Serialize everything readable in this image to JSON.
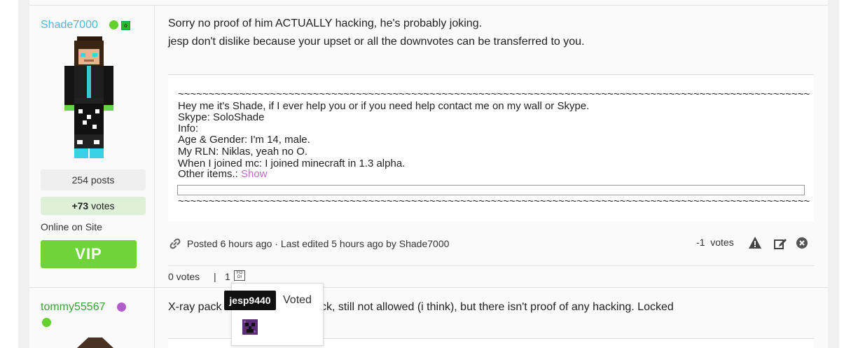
{
  "post1": {
    "author": {
      "username": "Shade7000",
      "posts_label": "254 posts",
      "votes_value": "+73",
      "votes_suffix": " votes",
      "status": "Online on Site",
      "rank": "VIP",
      "badge_text": "o"
    },
    "body_lines": [
      "Sorry no proof of him ACTUALLY hacking, he's probably joking.",
      "jesp don't dislike because your upset or all the downvotes can be transferred to you."
    ],
    "signature": {
      "rule": "~~~~~~~~~~~~~~~~~~~~~~~~~~~~~~~~~~~~~~~~~~~~~~~~~~~~~~~~~~~~~~~~~~~~~~~~~~~~~~~~~~~~~~~~~~~~~~~~~~~~~~~",
      "lines": [
        "Hey me it's Shade, if I ever help you or if you need help contact me on my wall or Skype.",
        "Skype: SoloShade",
        "Info:",
        "Age & Gender: I'm 14, male.",
        "My RLN: Niklas, yeah no O.",
        "When I joined mc: I joined minecraft in 1.3 alpha."
      ],
      "other_items_label": "Other items.: ",
      "show_link": "Show"
    },
    "meta": {
      "posted": "Posted 6 hours ago",
      "separator": " · ",
      "edited": "Last edited 5 hours ago by Shade7000"
    },
    "vote_count": "-1",
    "vote_label": "votes",
    "footer": {
      "votes_label": "0 votes",
      "separator": "|",
      "count": "1",
      "flag_text": "FO\nDI"
    }
  },
  "popup": {
    "title": "Voted",
    "tooltip": "jesp9440"
  },
  "post2": {
    "author": {
      "username": "tommy55567"
    },
    "body_visible_left": "X-ray pack",
    "body_visible_right": "ck, still not allowed (i think), but there isn't proof of any hacking. Locked"
  },
  "colors": {
    "username_shade": "#4fb8d8",
    "username_tommy": "#3aa33a",
    "online_dot": "#62d12b",
    "purple_dot": "#b25ccc",
    "vip_button": "#6ed43a",
    "votes_bg": "#dff0d8",
    "show_link": "#c06dc0"
  },
  "icons": [
    "link-icon",
    "warning-icon",
    "edit-icon",
    "close-icon",
    "flag-icon"
  ]
}
